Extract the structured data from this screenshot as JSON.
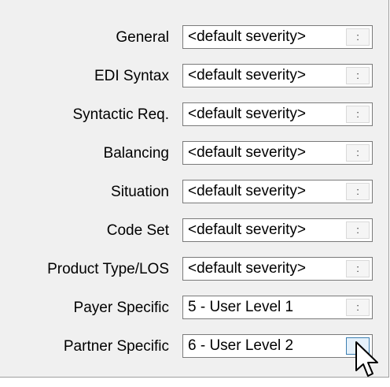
{
  "severity_rows": [
    {
      "label": "General",
      "value": "<default severity>",
      "button": ":"
    },
    {
      "label": "EDI Syntax",
      "value": "<default severity>",
      "button": ":"
    },
    {
      "label": "Syntactic Req.",
      "value": "<default severity>",
      "button": ":"
    },
    {
      "label": "Balancing",
      "value": "<default severity>",
      "button": ":"
    },
    {
      "label": "Situation",
      "value": "<default severity>",
      "button": ":"
    },
    {
      "label": "Code Set",
      "value": "<default severity>",
      "button": ":"
    },
    {
      "label": "Product Type/LOS",
      "value": "<default severity>",
      "button": ":"
    },
    {
      "label": "Payer Specific",
      "value": "5 - User Level 1",
      "button": ":"
    },
    {
      "label": "Partner Specific",
      "value": "6 - User Level 2",
      "button": ":"
    }
  ],
  "hovered_button_row": 8,
  "cursor_icon": "arrow-pointer-icon",
  "colors": {
    "panel_bg": "#f0f0f0",
    "field_border": "#7a7a7a",
    "hover_button_bg": "#e5f1fb",
    "hover_button_border": "#3c7fb1"
  }
}
